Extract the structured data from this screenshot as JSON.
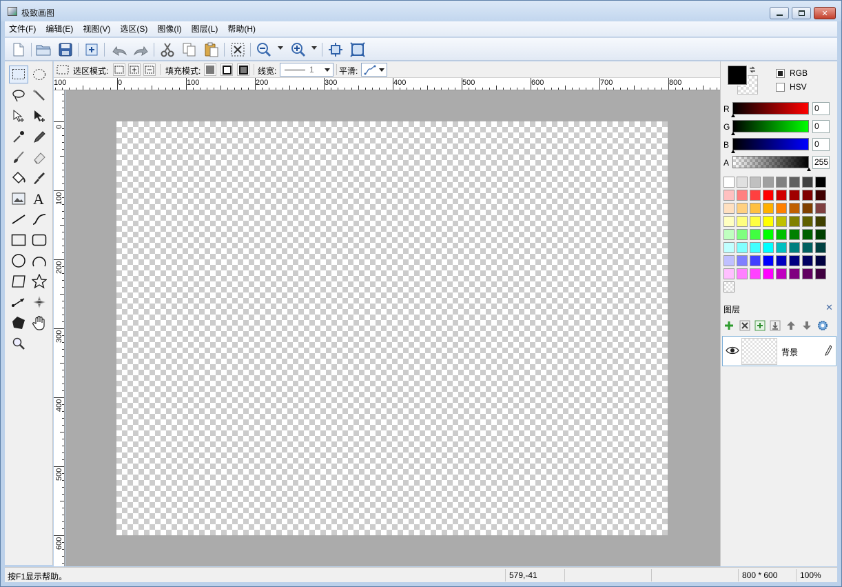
{
  "window": {
    "title": "极致画图"
  },
  "menu": [
    {
      "label": "文件(F)"
    },
    {
      "label": "编辑(E)"
    },
    {
      "label": "视图(V)"
    },
    {
      "label": "选区(S)"
    },
    {
      "label": "图像(I)"
    },
    {
      "label": "图层(L)"
    },
    {
      "label": "帮助(H)"
    }
  ],
  "options": {
    "select_mode_label": "选区模式:",
    "fill_mode_label": "填充模式:",
    "line_width_label": "线宽:",
    "line_width_value": "1",
    "smooth_label": "平滑:"
  },
  "ruler": {
    "h_labels": [
      "100",
      "0",
      "100",
      "200",
      "300",
      "400",
      "500",
      "600",
      "700",
      "800"
    ],
    "v_labels": [
      "0",
      "100",
      "200",
      "300",
      "400",
      "500",
      "600"
    ]
  },
  "color": {
    "mode_rgb": "RGB",
    "mode_hsv": "HSV",
    "mode_selected": "RGB",
    "r_label": "R",
    "r_value": "0",
    "g_label": "G",
    "g_value": "0",
    "b_label": "B",
    "b_value": "0",
    "a_label": "A",
    "a_value": "255",
    "palette_rows": [
      [
        "#ffffff",
        "#e0e0e0",
        "#c0c0c0",
        "#a0a0a0",
        "#808080",
        "#606060",
        "#404040",
        "#000000"
      ],
      [
        "#ffc0c0",
        "#ff8080",
        "#ff4040",
        "#ff0000",
        "#d00000",
        "#a00000",
        "#800000",
        "#400000"
      ],
      [
        "#ffe0c0",
        "#ffd080",
        "#ffc040",
        "#ffb000",
        "#ff8000",
        "#c06000",
        "#804000",
        "#804040"
      ],
      [
        "#ffffc0",
        "#ffff80",
        "#ffff40",
        "#ffff00",
        "#c0c000",
        "#808000",
        "#606000",
        "#404000"
      ],
      [
        "#c0ffc0",
        "#80ff80",
        "#40ff40",
        "#00ff00",
        "#00c000",
        "#008000",
        "#006000",
        "#004000"
      ],
      [
        "#c0ffff",
        "#80ffff",
        "#40ffff",
        "#00ffff",
        "#00c0c0",
        "#008080",
        "#006060",
        "#004040"
      ],
      [
        "#c0c0ff",
        "#8080ff",
        "#4040ff",
        "#0000ff",
        "#0000c0",
        "#000080",
        "#000060",
        "#000040"
      ],
      [
        "#ffc0ff",
        "#ff80ff",
        "#ff40ff",
        "#ff00ff",
        "#c000c0",
        "#800080",
        "#600060",
        "#400040"
      ]
    ]
  },
  "layers": {
    "title": "图层",
    "items": [
      {
        "name": "背景",
        "visible": true
      }
    ]
  },
  "status": {
    "help_text": "按F1显示帮助。",
    "cursor_pos": "579,-41",
    "image_size": "800 * 600",
    "zoom": "100%"
  }
}
